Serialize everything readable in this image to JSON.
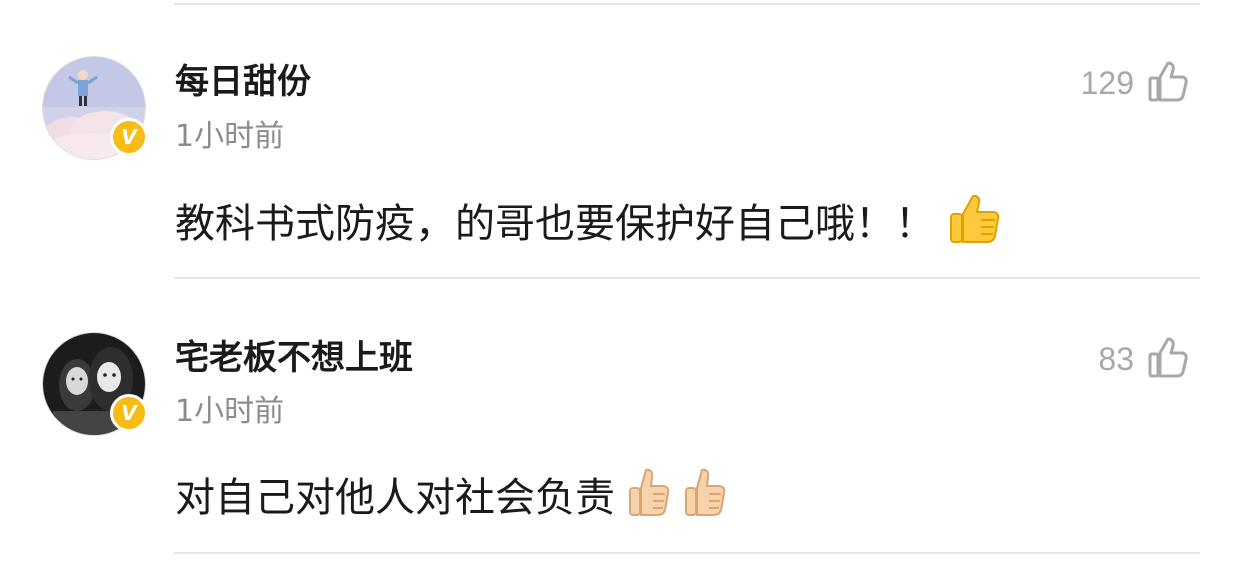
{
  "comments": [
    {
      "username": "每日甜份",
      "time": "1小时前",
      "text": "教科书式防疫，的哥也要保护好自己哦！！",
      "emojis": [
        "thumbs-up-emoji"
      ],
      "likes": "129",
      "verified": true,
      "badge_label": "V"
    },
    {
      "username": "宅老板不想上班",
      "time": "1小时前",
      "text": "对自己对他人对社会负责",
      "emojis": [
        "thumbs-up-emoji",
        "thumbs-up-emoji"
      ],
      "likes": "83",
      "verified": true,
      "badge_label": "V"
    }
  ],
  "colors": {
    "username": "#1a1a1a",
    "meta": "#8c8c8c",
    "like": "#a8a8a8",
    "badge": "#f6bd17",
    "divider": "#e6e6e6"
  }
}
